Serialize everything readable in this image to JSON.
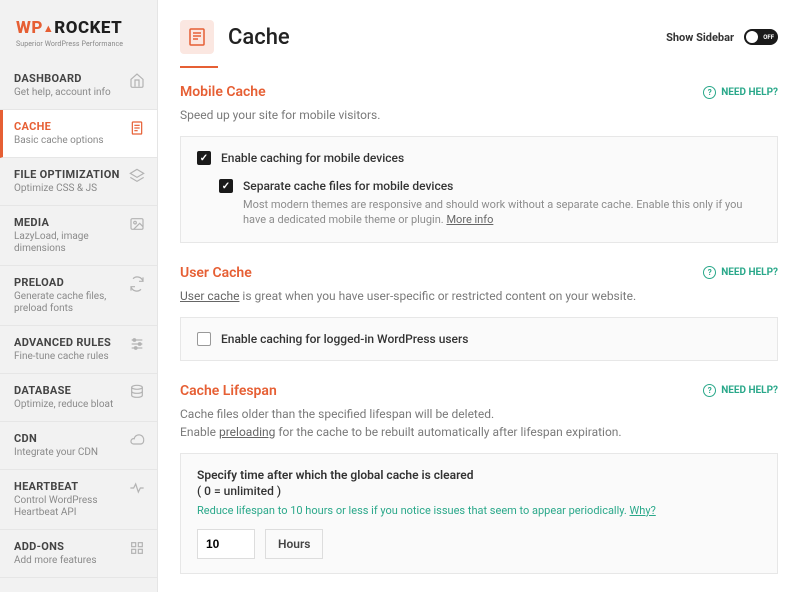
{
  "brand": {
    "wp": "WP",
    "rocket": "ROCKET",
    "tagline": "Superior WordPress Performance"
  },
  "nav": [
    {
      "title": "DASHBOARD",
      "sub": "Get help, account info",
      "icon": "home"
    },
    {
      "title": "CACHE",
      "sub": "Basic cache options",
      "icon": "file",
      "active": true
    },
    {
      "title": "FILE OPTIMIZATION",
      "sub": "Optimize CSS & JS",
      "icon": "layers"
    },
    {
      "title": "MEDIA",
      "sub": "LazyLoad, image dimensions",
      "icon": "image"
    },
    {
      "title": "PRELOAD",
      "sub": "Generate cache files, preload fonts",
      "icon": "refresh"
    },
    {
      "title": "ADVANCED RULES",
      "sub": "Fine-tune cache rules",
      "icon": "sliders"
    },
    {
      "title": "DATABASE",
      "sub": "Optimize, reduce bloat",
      "icon": "database"
    },
    {
      "title": "CDN",
      "sub": "Integrate your CDN",
      "icon": "cloud"
    },
    {
      "title": "HEARTBEAT",
      "sub": "Control WordPress Heartbeat API",
      "icon": "heart"
    },
    {
      "title": "ADD-ONS",
      "sub": "Add more features",
      "icon": "grid"
    }
  ],
  "header": {
    "title": "Cache",
    "show_sidebar": "Show Sidebar",
    "toggle_off": "OFF"
  },
  "help": "NEED HELP?",
  "sections": {
    "mobile": {
      "title": "Mobile Cache",
      "desc": "Speed up your site for mobile visitors.",
      "opt1": "Enable caching for mobile devices",
      "opt2": "Separate cache files for mobile devices",
      "opt2_desc": "Most modern themes are responsive and should work without a separate cache. Enable this only if you have a dedicated mobile theme or plugin.",
      "more_info": "More info"
    },
    "user": {
      "title": "User Cache",
      "desc_a": "User cache",
      "desc_b": " is great when you have user-specific or restricted content on your website.",
      "opt1": "Enable caching for logged-in WordPress users"
    },
    "lifespan": {
      "title": "Cache Lifespan",
      "desc1": "Cache files older than the specified lifespan will be deleted.",
      "desc2a": "Enable ",
      "desc2_link": "preloading",
      "desc2b": " for the cache to be rebuilt automatically after lifespan expiration.",
      "panel_head": "Specify time after which the global cache is cleared",
      "panel_head2": "( 0 = unlimited )",
      "hint": "Reduce lifespan to 10 hours or less if you notice issues that seem to appear periodically. ",
      "hint_link": "Why?",
      "value": "10",
      "unit": "Hours"
    }
  }
}
